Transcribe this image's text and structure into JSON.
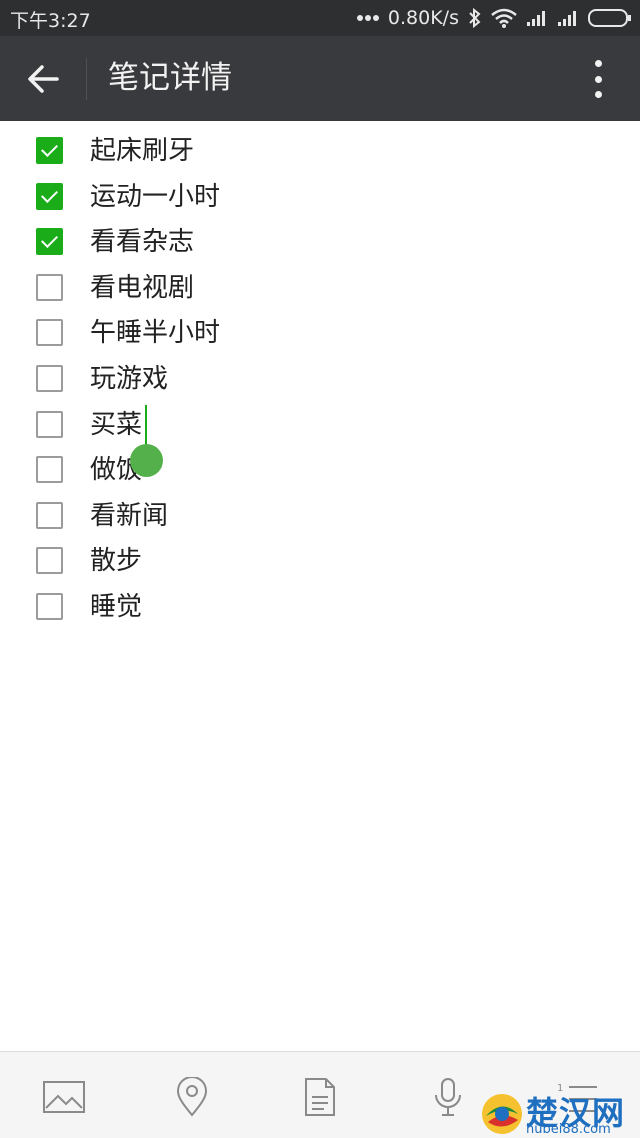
{
  "statusbar": {
    "time": "下午3:27",
    "network_speed": "0.80K/s",
    "icons": [
      "dots-icon",
      "bluetooth-icon",
      "wifi-icon",
      "signal-icon",
      "signal-icon",
      "battery-icon"
    ]
  },
  "appbar": {
    "back_icon": "back-arrow-icon",
    "title": "笔记详情",
    "more_icon": "more-vertical-icon"
  },
  "checklist": [
    {
      "text": "起床刷牙",
      "checked": true
    },
    {
      "text": "运动一小时",
      "checked": true
    },
    {
      "text": "看看杂志",
      "checked": true
    },
    {
      "text": "看电视剧",
      "checked": false
    },
    {
      "text": "午睡半小时",
      "checked": false
    },
    {
      "text": "玩游戏",
      "checked": false
    },
    {
      "text": "买菜",
      "checked": false
    },
    {
      "text": "做饭",
      "checked": false
    },
    {
      "text": "看新闻",
      "checked": false
    },
    {
      "text": "散步",
      "checked": false
    },
    {
      "text": "睡觉",
      "checked": false
    }
  ],
  "toolbar": {
    "icons": [
      "image-icon",
      "location-icon",
      "document-icon",
      "microphone-icon",
      "list-icon"
    ]
  },
  "watermark": {
    "text": "楚汉网",
    "url": "hubei88.com"
  },
  "colors": {
    "accent": "#1aad19",
    "appbar": "#393a3d",
    "statusbar": "#2e2f31"
  }
}
